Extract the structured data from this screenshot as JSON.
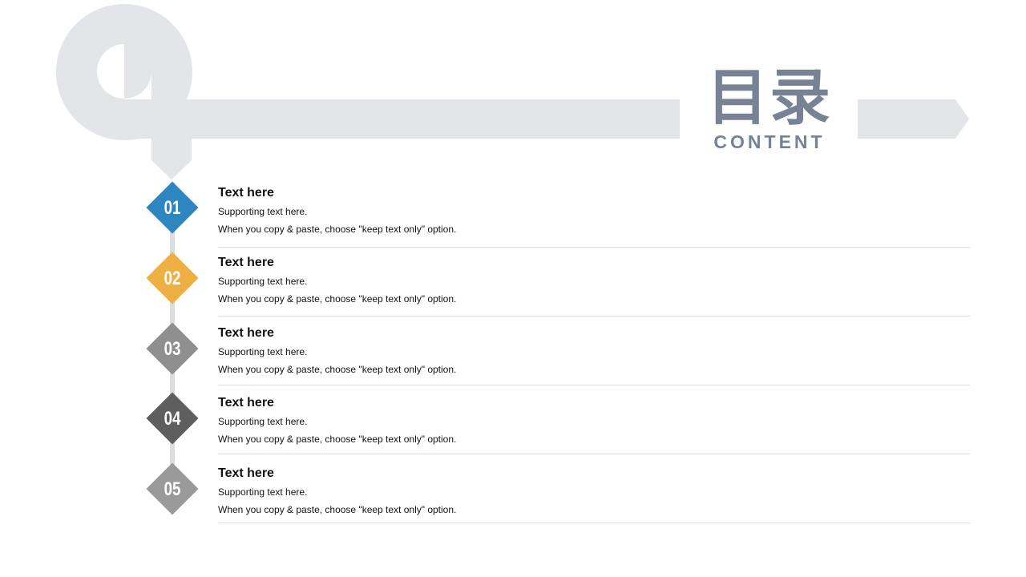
{
  "header": {
    "title": "目录",
    "subtitle": "CONTENT"
  },
  "colors": {
    "band": "#e4e5e8",
    "title": "#778394",
    "item1": "#2e86c1",
    "item2": "#efb043",
    "item3": "#8f8f8f",
    "item4": "#5e5e5e",
    "item5": "#9a9a9a"
  },
  "items": [
    {
      "number": "01",
      "title": "Text here",
      "line1": "Supporting text here.",
      "line2": "When you copy & paste, choose \"keep text only\" option."
    },
    {
      "number": "02",
      "title": "Text here",
      "line1": "Supporting text here.",
      "line2": "When you copy & paste, choose \"keep text only\" option."
    },
    {
      "number": "03",
      "title": "Text here",
      "line1": "Supporting text here.",
      "line2": "When you copy & paste, choose \"keep text only\" option."
    },
    {
      "number": "04",
      "title": "Text here",
      "line1": "Supporting text here.",
      "line2": "When you copy & paste, choose \"keep text only\" option."
    },
    {
      "number": "05",
      "title": "Text here",
      "line1": "Supporting text here.",
      "line2": "When you copy & paste, choose \"keep text only\" option."
    }
  ]
}
